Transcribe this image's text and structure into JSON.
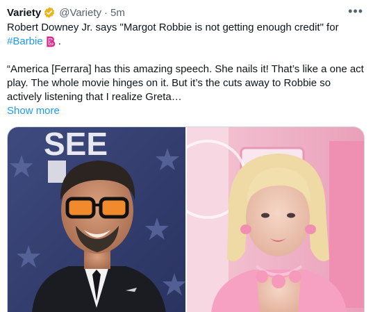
{
  "tweet": {
    "author_name": "Variety",
    "author_handle": "@Variety",
    "separator": "·",
    "timestamp": "5m",
    "more_icon": "more-horizontal-icon",
    "verified_icon": "gold-verified-badge-icon",
    "text_line1": "Robert Downey Jr. says \"Margot Robbie is not getting enough credit\" for",
    "hashtag": "#Barbie",
    "hashtag_emoji_icon": "pink-barbie-b-icon",
    "line2_suffix": ".",
    "quote": "“America [Ferrara] has this amazing speech. She nails it! That’s like a one act play. The whole movie hinges on it. But it’s the cuts away to Robbie so actively listening that I realize Greta…",
    "show_more": "Show more"
  },
  "media": {
    "left_photo_text": "SEE",
    "left_photo_icon": "photo-man-tinted-glasses",
    "right_photo_icon": "photo-woman-pink-shell-necklace"
  },
  "colors": {
    "link": "#1d9bf0",
    "secondary_text": "#536471",
    "verified_gold": "#e8b31b"
  }
}
